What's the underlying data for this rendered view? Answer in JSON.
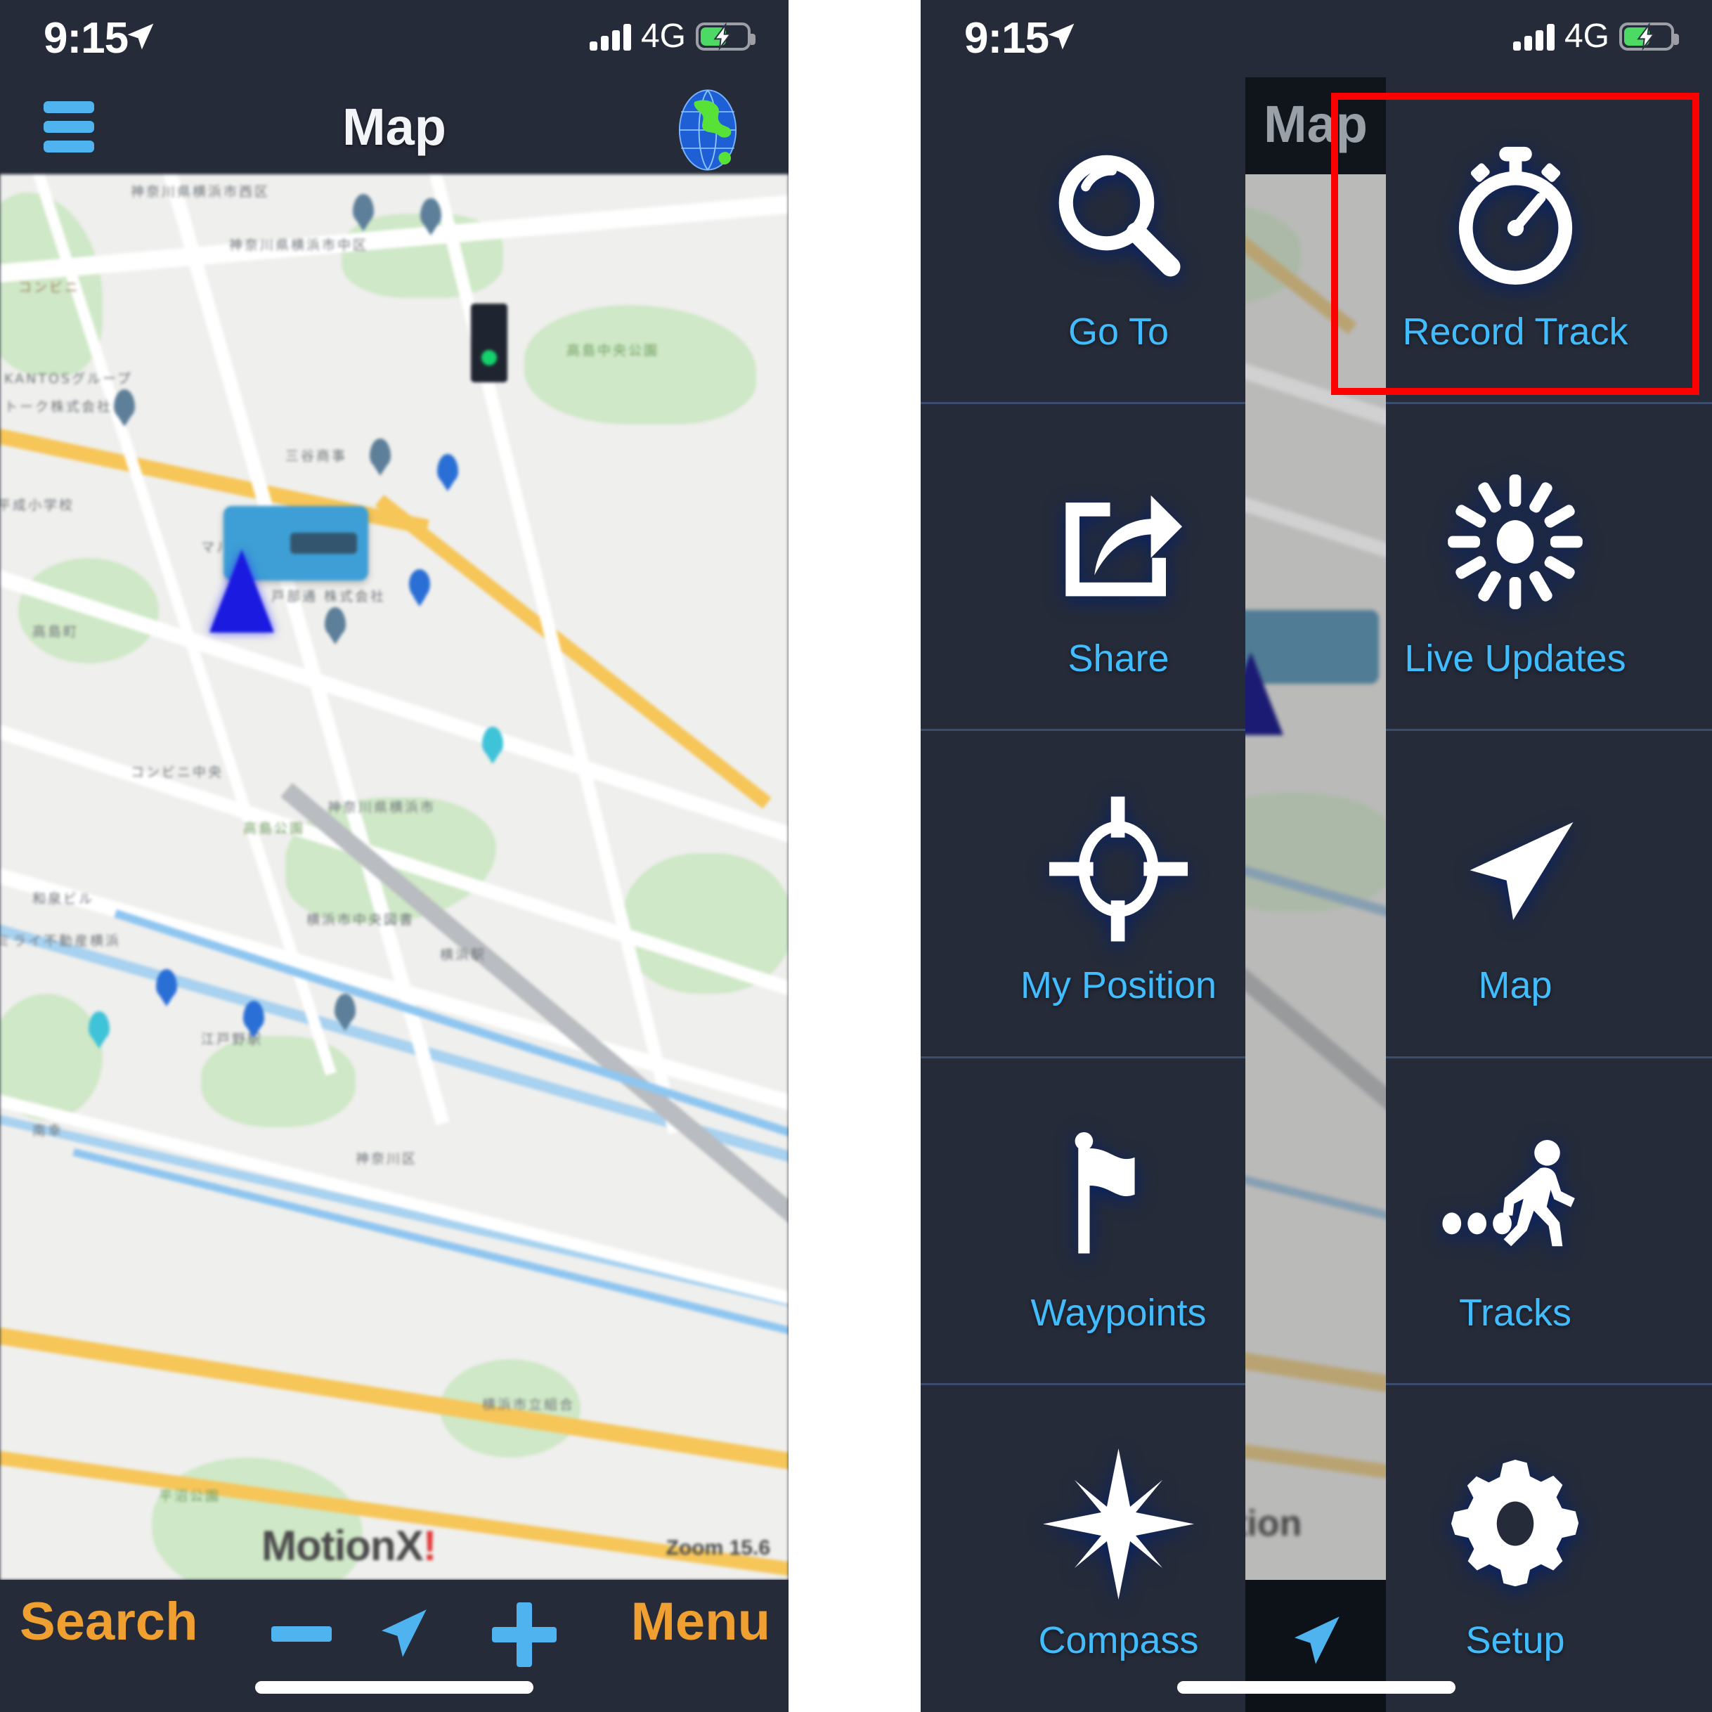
{
  "status_bar": {
    "time": "9:15",
    "network": "4G",
    "location_icon": "location-arrow-icon",
    "signal_icon": "cellular-signal-icon",
    "battery_icon": "battery-charging-icon",
    "battery_level_percent": 52,
    "battery_color": "#4cd964"
  },
  "left_phone": {
    "navbar": {
      "title": "Map",
      "menu_icon": "hamburger-menu-icon",
      "globe_icon": "globe-icon",
      "accent_color": "#4fb3f0"
    },
    "map": {
      "watermark_prefix": "MotionX",
      "watermark_suffix": "!",
      "zoom_label": "Zoom 15.6",
      "labels": [
        "神奈川県横浜市西区",
        "コンビニ",
        "KANTOSグループ",
        "トーク株式会社",
        "三谷商事",
        "マルエツ",
        "高島町",
        "平成小学校",
        "横浜駅",
        "江戸野駅"
      ]
    },
    "toolbar": {
      "search_label": "Search",
      "menu_label": "Menu",
      "zoom_out_icon": "minus-icon",
      "locate_icon": "navigation-arrow-icon",
      "zoom_in_icon": "plus-icon",
      "label_color": "#f0a030",
      "icon_color": "#4fb3f0",
      "highlight_color": "#ff0000",
      "highlighted_item": "Menu"
    },
    "home_indicator": "home-indicator"
  },
  "right_phone": {
    "background_title": "Map",
    "menu": {
      "items": [
        {
          "label": "Go To",
          "icon": "magnifier-icon",
          "col": "left",
          "row": 1,
          "highlighted": false
        },
        {
          "label": "Record Track",
          "icon": "stopwatch-icon",
          "col": "right",
          "row": 1,
          "highlighted": true
        },
        {
          "label": "Share",
          "icon": "share-arrow-icon",
          "col": "left",
          "row": 2,
          "highlighted": false
        },
        {
          "label": "Live Updates",
          "icon": "sun-burst-icon",
          "col": "right",
          "row": 2,
          "highlighted": false
        },
        {
          "label": "My Position",
          "icon": "crosshair-target-icon",
          "col": "left",
          "row": 3,
          "highlighted": false
        },
        {
          "label": "Map",
          "icon": "navigation-arrow-icon",
          "col": "right",
          "row": 3,
          "highlighted": false
        },
        {
          "label": "Waypoints",
          "icon": "flag-icon",
          "col": "left",
          "row": 4,
          "highlighted": false
        },
        {
          "label": "Tracks",
          "icon": "walking-person-icon",
          "col": "right",
          "row": 4,
          "highlighted": false
        },
        {
          "label": "Compass",
          "icon": "compass-star-icon",
          "col": "left",
          "row": 5,
          "highlighted": false
        },
        {
          "label": "Setup",
          "icon": "gear-icon",
          "col": "right",
          "row": 5,
          "highlighted": false
        }
      ],
      "label_color": "#41bdff",
      "icon_color": "#ffffff",
      "highlight_color": "#ff0000",
      "divider_color": "#3b4d6b"
    },
    "home_indicator": "home-indicator"
  },
  "theme": {
    "chrome_background": "#252b39",
    "page_background": "#ffffff"
  }
}
